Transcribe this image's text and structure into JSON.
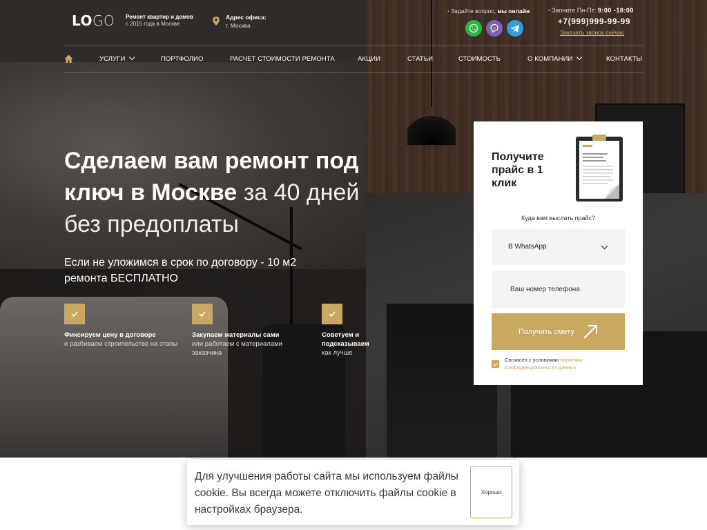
{
  "header": {
    "logo_bold": "LO",
    "logo_light": "GO",
    "tagline_line1": "Ремонт квартир и домов",
    "tagline_line2": "с 2015 года в Москве",
    "address_label": "Адрес офиса:",
    "address_value": "г. Москва",
    "ask_prefix": "Задайте вопрос,",
    "ask_status": "мы онлайн",
    "hours_prefix": "Звоните Пн-Пт:",
    "hours_value": "9:00 -18:00",
    "phone": "+7(999)999-99-99",
    "callback_link": "Заказать звонок сейчас",
    "messengers": [
      "whatsapp-icon",
      "viber-icon",
      "telegram-icon"
    ]
  },
  "nav": {
    "items": [
      {
        "label": "УСЛУГИ",
        "dropdown": true
      },
      {
        "label": "ПОРТФОЛИО",
        "dropdown": false
      },
      {
        "label": "РАСЧЕТ СТОИМОСТИ РЕМОНТА",
        "dropdown": false
      },
      {
        "label": "АКЦИИ",
        "dropdown": false
      },
      {
        "label": "СТАТЬИ",
        "dropdown": false
      },
      {
        "label": "СТОИМОСТЬ",
        "dropdown": false
      },
      {
        "label": "О КОМПАНИИ",
        "dropdown": true
      },
      {
        "label": "КОНТАКТЫ",
        "dropdown": false
      }
    ]
  },
  "hero": {
    "headline_bold_1": "Сделаем вам ремонт под ключ в Москве",
    "headline_light": "за 40 дней без предоплаты",
    "subline": "Если не уложимся в срок по договору - 10 м2 ремонта БЕСПЛАТНО",
    "features": [
      {
        "title": "Фиксируем цену в договоре",
        "text": "и разбиваем строительство на этапы"
      },
      {
        "title": "Закупаем материалы сами",
        "text": "или работаем с материалами заказчика"
      },
      {
        "title": "Советуем и подсказываем",
        "text": "как лучше"
      }
    ]
  },
  "form": {
    "title": "Получите прайс в 1 клик",
    "question": "Куда вам выслать прайс?",
    "select_value": "В WhatsApp",
    "phone_placeholder": "Ваш номер телефона",
    "submit_label": "Получить смету",
    "agree_text": "Согласен с условиями",
    "agree_link": "политики конфиденциальности данных",
    "agree_checked": true
  },
  "cookie": {
    "text": "Для улучшения работы сайта мы используем файлы cookie. Вы всегда можете отключить файлы cookie в настройках браузера.",
    "button_label": "Хорошо"
  },
  "colors": {
    "accent": "#c9a860",
    "whatsapp": "#25b944",
    "viber": "#7d62b0",
    "telegram": "#2aa1da"
  }
}
